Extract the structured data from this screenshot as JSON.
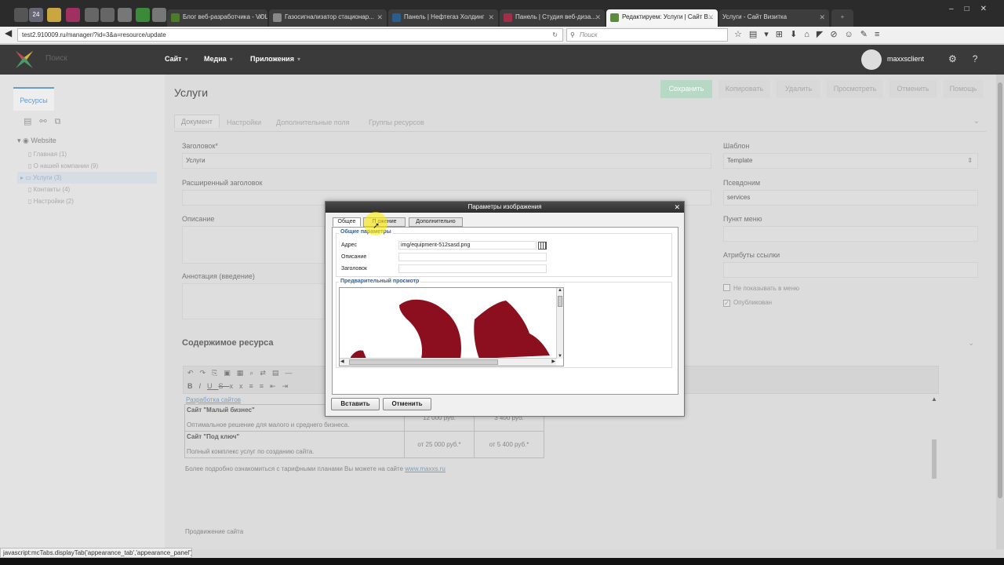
{
  "browser": {
    "tabs": [
      {
        "label": "Блог веб-разработчика - VOL...",
        "color": "#4a7c2a"
      },
      {
        "label": "Газосигнализатор стационар...",
        "color": "#888888"
      },
      {
        "label": "Панель | Нефтегаз Холдинг",
        "color": "#2a5d8c"
      },
      {
        "label": "Панель | Студия веб-диза...",
        "color": "#a0304a"
      },
      {
        "label": "Редактируем: Услуги | Сайт В...",
        "color": "#5a8c3c"
      },
      {
        "label": "Услуги - Сайт Визитка",
        "color": "#888888"
      }
    ],
    "pinned_badge": "24",
    "url": "test2.910009.ru/manager/?id=3&a=resource/update",
    "search_placeholder": "Поиск"
  },
  "header": {
    "search_placeholder": "Поиск",
    "nav": [
      {
        "label": "Сайт"
      },
      {
        "label": "Медиа"
      },
      {
        "label": "Приложения"
      }
    ],
    "username": "maxxsclient"
  },
  "sidebar": {
    "tab_label": "Ресурсы",
    "root": "Website",
    "items": [
      {
        "label": "Главная (1)"
      },
      {
        "label": "О нашей компании (9)"
      },
      {
        "label": "Услуги (3)"
      },
      {
        "label": "Контакты (4)"
      },
      {
        "label": "Настройки (2)"
      }
    ]
  },
  "page": {
    "title": "Услуги",
    "buttons": {
      "save": "Сохранить",
      "copy": "Копировать",
      "delete": "Удалить",
      "view": "Просмотреть",
      "cancel": "Отменить",
      "help": "Помощь"
    },
    "tabs": [
      "Документ",
      "Настройки",
      "Дополнительные поля",
      "Группы ресурсов"
    ],
    "fields": {
      "title_label": "Заголовок*",
      "title_value": "Услуги",
      "longtitle_label": "Расширенный заголовок",
      "description_label": "Описание",
      "introtext_label": "Аннотация (введение)",
      "template_label": "Шаблон",
      "template_value": "Template",
      "alias_label": "Псевдоним",
      "alias_value": "services",
      "menutitle_label": "Пункт меню",
      "link_attr_label": "Атрибуты ссылки",
      "hide_menu_label": "Не показывать в меню",
      "published_label": "Опубликован"
    },
    "content_section": "Содержимое ресурса",
    "editor": {
      "link_text": "Разработка сайтов",
      "rows": [
        {
          "name": "Сайт \"Малый бизнес\"",
          "desc": "Оптимальное решение для малого и среднего бизнеса.",
          "price1": "12 000 руб.",
          "price2": "3 400 руб."
        },
        {
          "name": "Сайт \"Под ключ\"",
          "desc": "Полный комплекс услуг по созданию сайта.",
          "price1": "от 25 000 руб.*",
          "price2": "от 5 400 руб.*"
        }
      ],
      "more_text": "Более подробно ознакомиться с тарифными планами Вы можете на сайте",
      "more_link": "www.maxxs.ru",
      "promo": "Продвижение сайта"
    }
  },
  "dialog": {
    "title": "Параметры изображения",
    "tabs": [
      "Общее",
      "Внешний вид",
      "Дополнительно"
    ],
    "tab2_visible": "П    ожение",
    "general_legend": "Общие параметры",
    "src_label": "Адрес",
    "src_value": "img/equipment-512sasd.png",
    "alt_label": "Описание",
    "title_label": "Заголовок",
    "preview_legend": "Предварительный просмотр",
    "insert_button": "Вставить",
    "cancel_button": "Отменить",
    "shape_color": "#8b0f1e"
  },
  "status_text": "javascript:mcTabs.displayTab('appearance_tab','appearance_panel');"
}
